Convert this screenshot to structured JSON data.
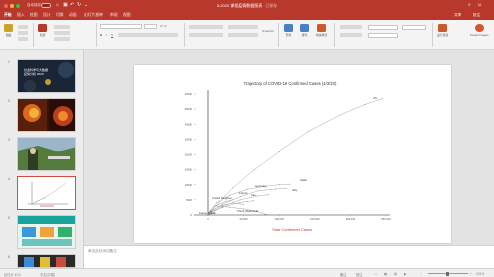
{
  "window": {
    "autosave_label": "自动保存",
    "toggle_label": "关闭",
    "title": "3-2020 课程疫情数据图表",
    "title_suffix": "已保存"
  },
  "ribbon": {
    "tabs": [
      "开始",
      "插入",
      "绘图",
      "设计",
      "切换",
      "动画",
      "幻灯片放映",
      "审阅",
      "视图"
    ],
    "active_tab": 0,
    "share_label": "共享",
    "comments_label": "批注",
    "tools": [
      {
        "label": "粘贴",
        "color": "#c9a227"
      },
      {
        "label": "新建",
        "color": "#b8382c"
      },
      {
        "label": "版式",
        "color": "#8f8f8f"
      },
      {
        "label": "形状",
        "color": "#4a7ec7"
      },
      {
        "label": "排列",
        "color": "#4a7ec7"
      },
      {
        "label": "快速样式",
        "color": "#c95a2a"
      },
      {
        "label": "设计灵感",
        "color": "#c95a2a"
      },
      {
        "label": "Pocket Images",
        "color": "#d9532c"
      }
    ],
    "font_name": "",
    "font_size": ""
  },
  "slides": {
    "numbers": [
      "1",
      "2",
      "3",
      "4",
      "5",
      "6"
    ],
    "selected_index": 3,
    "thumb_1_line1": "社会科学与大数据",
    "thumb_1_line2": "疫情分析 2020"
  },
  "chart_data": {
    "type": "line",
    "title": "Trajectory of COVID-19 Confirmed Cases (4/3/20)",
    "xlabel": "Total Confirmed Cases",
    "ylabel": "",
    "xlim": [
      0,
      250000
    ],
    "ylim": [
      0,
      40000
    ],
    "x_ticks": [
      "0",
      "50,000",
      "100,000",
      "150,000",
      "200,000",
      "250,000"
    ],
    "y_ticks": [
      "0",
      "5000",
      "10000",
      "15000",
      "20000",
      "25000",
      "30000",
      "35000",
      "40000"
    ],
    "series": [
      {
        "name": "US",
        "x": [
          0,
          1000,
          5000,
          15000,
          35000,
          65000,
          100000,
          140000,
          185000,
          220000,
          245000
        ],
        "y": [
          0,
          300,
          1500,
          4000,
          9000,
          15000,
          21000,
          27500,
          33000,
          36500,
          38500
        ]
      },
      {
        "name": "Italy",
        "x": [
          0,
          3000,
          12000,
          30000,
          55000,
          80000,
          100000,
          115000
        ],
        "y": [
          0,
          1500,
          4000,
          6500,
          8500,
          9500,
          10000,
          10200
        ]
      },
      {
        "name": "Spain",
        "x": [
          0,
          5000,
          20000,
          45000,
          70000,
          95000,
          110000
        ],
        "y": [
          0,
          1200,
          3500,
          6000,
          8000,
          8600,
          8800
        ]
      },
      {
        "name": "Germany",
        "x": [
          0,
          5000,
          20000,
          45000,
          70000,
          85000
        ],
        "y": [
          0,
          1000,
          2800,
          5000,
          6300,
          6700
        ]
      },
      {
        "name": "France",
        "x": [
          0,
          5000,
          20000,
          40000,
          55000,
          64000
        ],
        "y": [
          0,
          900,
          2500,
          3900,
          4500,
          4700
        ]
      },
      {
        "name": "Iran",
        "x": [
          0,
          5000,
          20000,
          35000,
          45000,
          50000
        ],
        "y": [
          0,
          1500,
          3200,
          4000,
          3700,
          3500
        ]
      },
      {
        "name": "United Kingdom",
        "x": [
          0,
          3000,
          12000,
          25000,
          34000
        ],
        "y": [
          0,
          1200,
          3200,
          4500,
          5000
        ]
      },
      {
        "name": "China",
        "x": [
          0,
          10000,
          30000,
          50000,
          68000,
          76000,
          80000,
          82000
        ],
        "y": [
          0,
          3000,
          2600,
          2000,
          1200,
          700,
          300,
          200
        ]
      },
      {
        "name": "Korea, South",
        "x": [
          0,
          2000,
          5000,
          8000,
          10000
        ],
        "y": [
          0,
          150,
          450,
          600,
          550
        ]
      }
    ]
  },
  "chart_labels": {
    "us": "US",
    "spain": "Spain",
    "italy": "Italy",
    "germany": "Germany",
    "france": "France",
    "iran": "Iran",
    "uk": "United Kingdom",
    "china": "China (Mainland)",
    "korea": "Korea, South"
  },
  "notes": {
    "placeholder": "单击此处添加备注"
  },
  "status": {
    "slide_info": "幻灯片 4/12",
    "language": "中文(中国)",
    "notes_btn": "备注",
    "comments_btn": "批注",
    "zoom": "101%"
  },
  "colors": {
    "ribbon": "#b8382c",
    "chart_line": "#9e9e9e",
    "axis": "#222222",
    "xlabel": "#c0392b",
    "selected_thumb": "#d24b3c"
  }
}
